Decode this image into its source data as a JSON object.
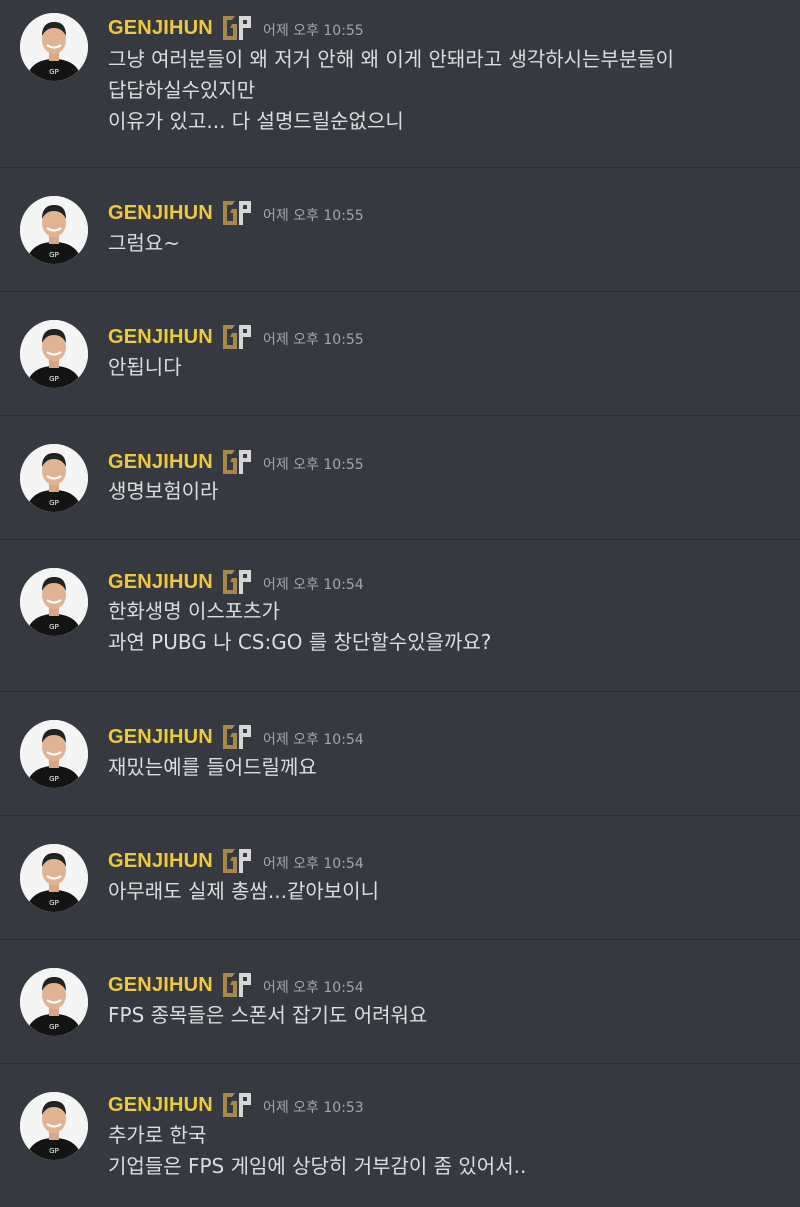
{
  "user": {
    "name": "GENJIHUN",
    "avatar": "avatar-photo",
    "badge": "gen-g-logo-icon"
  },
  "colors": {
    "background": "#36393f",
    "username": "#f0c83c",
    "timestamp": "#a3a6aa",
    "text": "#dcddde",
    "divider": "#2b2d31"
  },
  "messages": [
    {
      "time": "어제 오후 10:55",
      "lines": [
        "그냥 여러분들이 왜 저거 안해 왜 이게 안돼라고 생각하시는부분들이",
        "답답하실수있지만",
        "이유가 있고... 다 설명드릴순없으니"
      ]
    },
    {
      "time": "어제 오후 10:55",
      "lines": [
        "그럼요~"
      ]
    },
    {
      "time": "어제 오후 10:55",
      "lines": [
        "안됩니다"
      ]
    },
    {
      "time": "어제 오후 10:55",
      "lines": [
        "생명보험이라"
      ]
    },
    {
      "time": "어제 오후 10:54",
      "lines": [
        "한화생명 이스포츠가",
        "과연 PUBG 나 CS:GO 를 창단할수있을까요?"
      ]
    },
    {
      "time": "어제 오후 10:54",
      "lines": [
        "재밌는예를 들어드릴께요"
      ]
    },
    {
      "time": "어제 오후 10:54",
      "lines": [
        "아무래도 실제 총쌈...같아보이니"
      ]
    },
    {
      "time": "어제 오후 10:54",
      "lines": [
        "FPS 종목들은 스폰서 잡기도 어려워요"
      ]
    },
    {
      "time": "어제 오후 10:53",
      "lines": [
        "추가로 한국",
        "기업들은 FPS 게임에 상당히 거부감이 좀 있어서.."
      ]
    }
  ]
}
